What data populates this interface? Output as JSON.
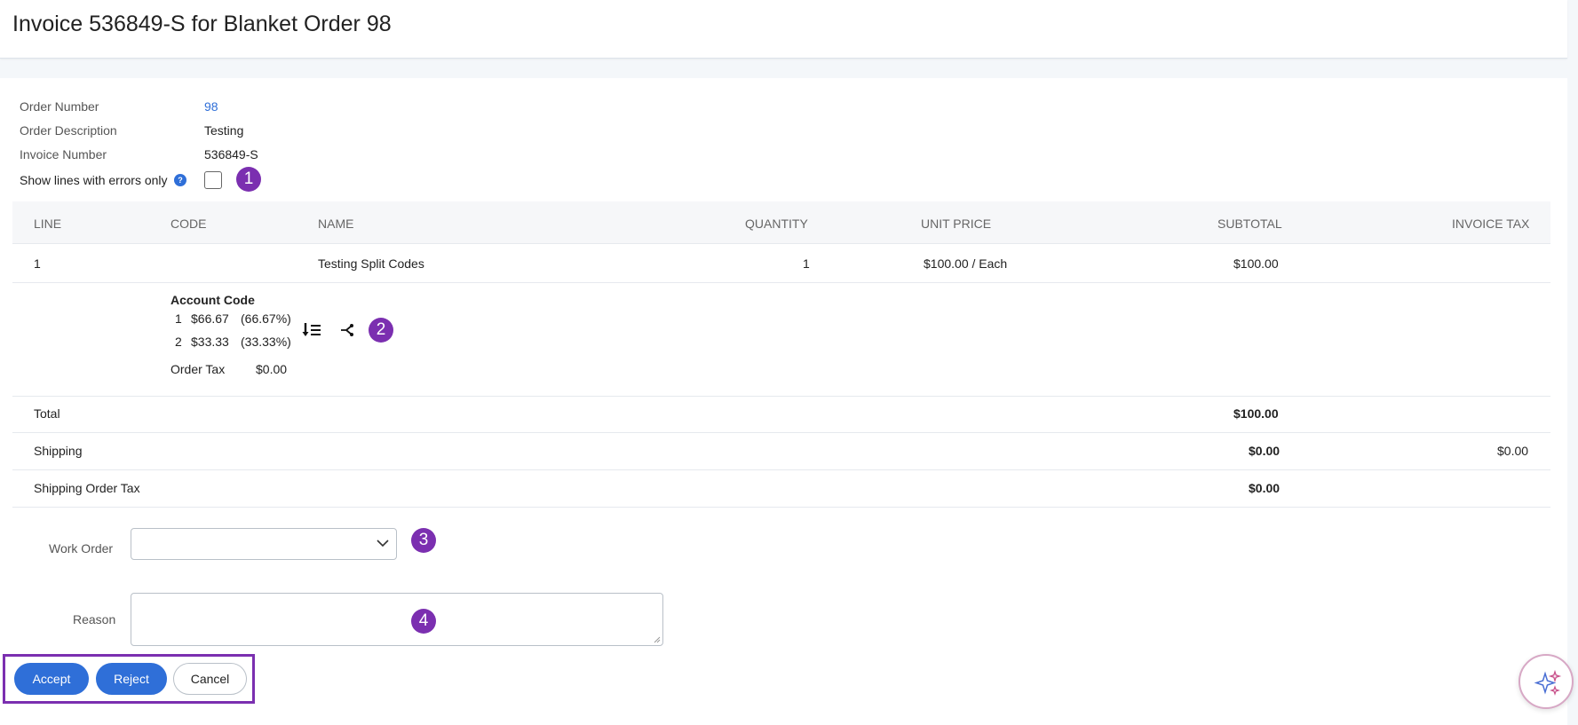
{
  "page": {
    "title": "Invoice 536849-S for Blanket Order 98"
  },
  "meta": {
    "order_number_label": "Order Number",
    "order_number_value": "98",
    "order_description_label": "Order Description",
    "order_description_value": "Testing",
    "invoice_number_label": "Invoice Number",
    "invoice_number_value": "536849-S",
    "errors_only_label": "Show lines with errors only",
    "errors_only_checked": false,
    "help_glyph": "?"
  },
  "badges": [
    "1",
    "2",
    "3",
    "4"
  ],
  "table": {
    "headers": [
      "LINE",
      "CODE",
      "NAME",
      "QUANTITY",
      "UNIT PRICE",
      "SUBTOTAL",
      "INVOICE TAX"
    ],
    "rows": [
      {
        "line": "1",
        "code": "",
        "name": "Testing Split Codes",
        "quantity": "1",
        "unit_price": "$100.00 / Each",
        "subtotal": "$100.00",
        "invoice_tax": ""
      }
    ],
    "detail": {
      "account_code_label": "Account Code",
      "splits": [
        {
          "index": "1",
          "amount": "$66.67",
          "percent": "(66.67%)"
        },
        {
          "index": "2",
          "amount": "$33.33",
          "percent": "(33.33%)"
        }
      ],
      "order_tax_label": "Order Tax",
      "order_tax_value": "$0.00",
      "icons": [
        "sort-list-icon",
        "split-icon"
      ]
    },
    "summary": [
      {
        "label": "Total",
        "subtotal": "$100.00",
        "invoice_tax": ""
      },
      {
        "label": "Shipping",
        "subtotal": "$0.00",
        "invoice_tax": "$0.00"
      },
      {
        "label": "Shipping Order Tax",
        "subtotal": "$0.00",
        "invoice_tax": ""
      }
    ]
  },
  "form": {
    "work_order_label": "Work Order",
    "work_order_value": "",
    "reason_label": "Reason",
    "reason_value": ""
  },
  "actions": {
    "accept_label": "Accept",
    "reject_label": "Reject",
    "cancel_label": "Cancel"
  },
  "colors": {
    "primary": "#2f6fd8",
    "badge": "#7b2fb0",
    "link": "#2f6fd8"
  }
}
